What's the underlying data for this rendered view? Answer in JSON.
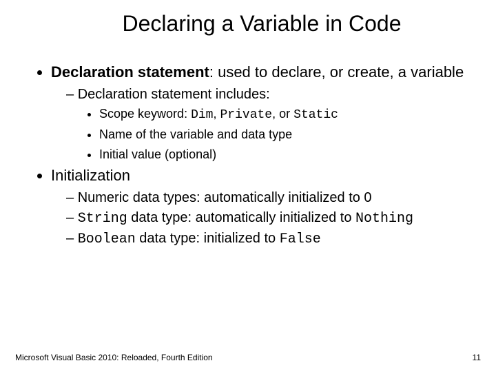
{
  "title": "Declaring a Variable in Code",
  "b1": {
    "term": "Declaration statement",
    "def": ": used to declare, or create, a variable",
    "sub1": "Declaration statement includes:",
    "s1a_pre": "Scope keyword: ",
    "s1a_c1": "Dim",
    "s1a_m1": ", ",
    "s1a_c2": "Private",
    "s1a_m2": ", or ",
    "s1a_c3": "Static",
    "s1b": "Name of the variable and data type",
    "s1c": "Initial value (optional)"
  },
  "b2": {
    "label": "Initialization",
    "sub1": "Numeric data types: automatically initialized to 0",
    "sub2_c1": "String",
    "sub2_m1": " data type: automatically initialized to ",
    "sub2_c2": "Nothing",
    "sub3_c1": "Boolean",
    "sub3_m1": " data type: initialized to ",
    "sub3_c2": "False"
  },
  "footer": {
    "book": "Microsoft Visual Basic 2010: Reloaded, Fourth Edition",
    "page": "11"
  }
}
